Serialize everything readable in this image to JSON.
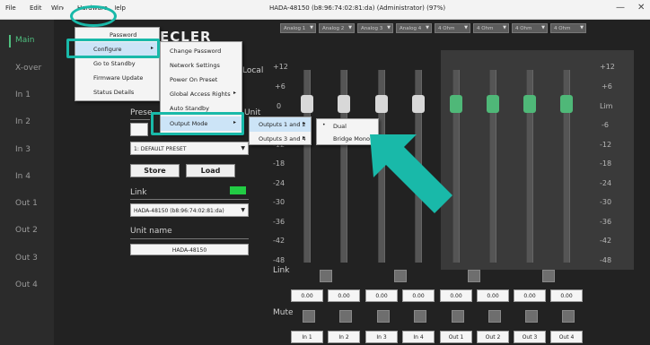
{
  "menubar": {
    "items": [
      "File",
      "Edit",
      "Window",
      "Hardware",
      "Help"
    ],
    "window_title": "HADA-48150 (b8:96:74:02:81:da) (Administrator) (97%)",
    "minimize": "—",
    "close": "✕"
  },
  "sidebar": {
    "items": [
      "Main",
      "X-over",
      "In 1",
      "In 2",
      "In 3",
      "In 4",
      "Out 1",
      "Out 2",
      "Out 3",
      "Out 4"
    ],
    "active": "Main"
  },
  "header": {
    "logo_text": "ECLER",
    "outputs": [
      "Analog 1",
      "Analog 2",
      "Analog 3",
      "Analog 4",
      "4 Ohm",
      "4 Ohm",
      "4 Ohm",
      "4 Ohm"
    ]
  },
  "left_panel": {
    "local_label": "Local",
    "unit_label": "Unit",
    "preset_label": "Prese",
    "preset_value": "1: DEFAULT PRESET",
    "store_label": "Store",
    "load_label": "Load",
    "link_label": "Link",
    "link_value": "HADA-48150 (b8:96:74:02:81:da)",
    "unit_name_label": "Unit name",
    "unit_name_value": "HADA-48150",
    "link_led_color": "#22cc44"
  },
  "meters": {
    "scale_left": [
      "+12",
      "+6",
      "0",
      "-6",
      "-12",
      "-18",
      "-24",
      "-30",
      "-36",
      "-42",
      "-48"
    ],
    "scale_right": [
      "+12",
      "+6",
      "Lim",
      "-6",
      "-12",
      "-18",
      "-24",
      "-30",
      "-36",
      "-42",
      "-48"
    ],
    "link_label": "Link",
    "mute_label": "Mute",
    "values": [
      "0.00",
      "0.00",
      "0.00",
      "0.00",
      "0.00",
      "0.00",
      "0.00",
      "0.00"
    ],
    "channels": [
      "In 1",
      "In 2",
      "In 3",
      "In 4",
      "Out 1",
      "Out 2",
      "Out 3",
      "Out 4"
    ],
    "input_knob_color": "#d8d8d8",
    "output_knob_color": "#4fb878"
  },
  "menus": {
    "hardware": [
      "Password",
      "Configure",
      "Go to Standby",
      "Firmware Update",
      "Status Details"
    ],
    "configure": [
      "Change Password",
      "Network Settings",
      "Power On Preset",
      "Global Access Rights",
      "Auto Standby",
      "Output Mode"
    ],
    "output_mode": [
      "Outputs 1 and 2",
      "Outputs 3 and 4"
    ],
    "outputs12": [
      "Dual",
      "Bridge Mono"
    ],
    "submenu_arrow": "▸",
    "selected_dot": "•"
  },
  "highlight_color": "#19b9a9"
}
